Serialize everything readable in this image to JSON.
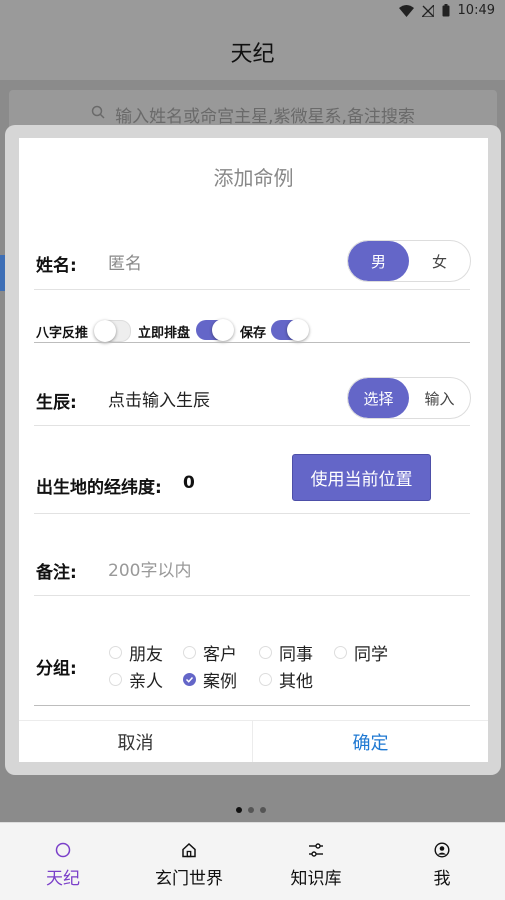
{
  "status_bar": {
    "time": "10:49"
  },
  "app": {
    "title": "天纪"
  },
  "background": {
    "search_placeholder": "输入姓名或命宫主星,紫微星系,备注搜索"
  },
  "dialog": {
    "title": "添加命例",
    "name": {
      "label": "姓名:",
      "placeholder": "匿名"
    },
    "gender": {
      "options": [
        "男",
        "女"
      ],
      "selected": "男"
    },
    "toggles": {
      "bazi_reverse": {
        "label": "八字反推",
        "on": false
      },
      "instant_chart": {
        "label": "立即排盘",
        "on": true
      },
      "save": {
        "label": "保存",
        "on": true
      }
    },
    "birth": {
      "label": "生辰:",
      "placeholder": "点击输入生辰"
    },
    "birth_mode": {
      "options": [
        "选择",
        "输入"
      ],
      "selected": "选择"
    },
    "location": {
      "label": "出生地的经纬度:",
      "value": "0",
      "button": "使用当前位置"
    },
    "note": {
      "label": "备注:",
      "placeholder": "200字以内"
    },
    "group": {
      "label": "分组:",
      "options": [
        "朋友",
        "客户",
        "同事",
        "同学",
        "亲人",
        "案例",
        "其他"
      ],
      "selected": "案例"
    },
    "cancel": "取消",
    "confirm": "确定"
  },
  "bottom_nav": {
    "items": [
      {
        "label": "天纪",
        "icon": "circle-icon"
      },
      {
        "label": "玄门世界",
        "icon": "home-icon"
      },
      {
        "label": "知识库",
        "icon": "sliders-icon"
      },
      {
        "label": "我",
        "icon": "user-circle-icon"
      }
    ],
    "active": "天纪"
  },
  "colors": {
    "accent": "#6466c8",
    "confirm_text": "#1e78d2",
    "nav_active": "#7a3fc9"
  }
}
